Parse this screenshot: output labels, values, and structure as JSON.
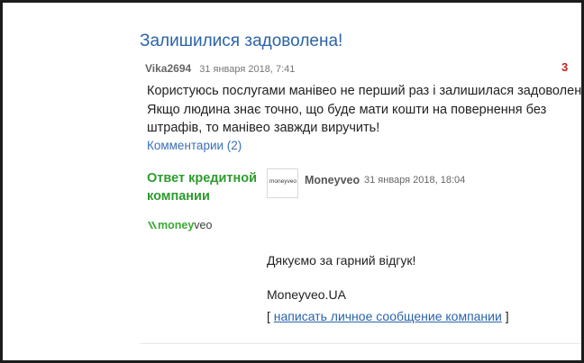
{
  "review": {
    "title": "Залишилися задоволена!",
    "author": "Vika2694",
    "date": "31 января 2018, 7:41",
    "rating": "3",
    "text_lines": [
      "Користуюсь послугами манівео не перший раз і залишилася задоволена,",
      "Якщо людина знає точно, що буде мати кошти на повернення без",
      "штрафів, то манівео завжди виручить!"
    ],
    "comments_link": "Комментарии (2)"
  },
  "reply": {
    "label_lines": [
      "Ответ кредитной",
      "компании"
    ],
    "logo_text_money": "money",
    "logo_text_veo": "veo",
    "small_logo_text": "moneyveo",
    "company_name": "Moneyveo",
    "date": "31 января 2018, 18:04",
    "thanks": "Дякуємо за гарний відгук!",
    "signature": "Moneyveo.UA",
    "pm_open": "[ ",
    "pm_link": "написать личное сообщение компании",
    "pm_close": " ]"
  },
  "colors": {
    "title": "#2a63a8",
    "link": "#3c70b4",
    "rating": "#c0241e",
    "reply_label": "#2e9b2e",
    "brand_green": "#3aaa35"
  }
}
